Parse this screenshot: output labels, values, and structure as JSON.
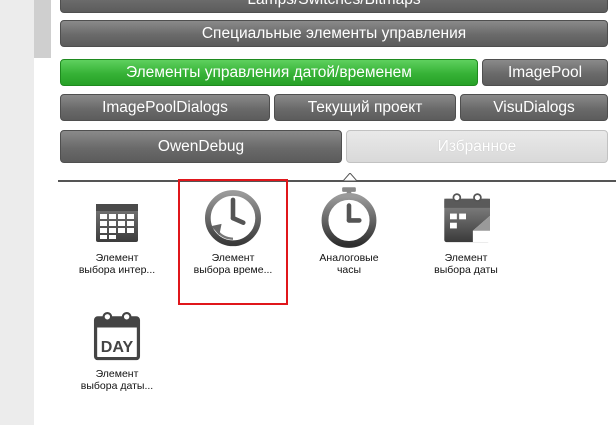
{
  "tabs": {
    "row0": "Lamps/Switches/Bitmaps",
    "row1": "Специальные элементы управления",
    "row2_active": "Элементы управления датой/временем",
    "row2_imagepool": "ImagePool",
    "row3_dialogs": "ImagePoolDialogs",
    "row3_project": "Текущий проект",
    "row3_visu": "VisuDialogs",
    "row4_owen": "OwenDebug",
    "row4_fav": "Избранное"
  },
  "colors": {
    "tab_dark": "#6a6a6a",
    "tab_active": "#36b236",
    "selection": "#e0161b"
  },
  "tools": [
    {
      "line1": "Элемент",
      "line2": "выбора интер...",
      "icon": "calendar-grid-icon"
    },
    {
      "line1": "Элемент",
      "line2": "выбора време...",
      "icon": "clock-pick-icon"
    },
    {
      "line1": "Аналоговые",
      "line2": "часы",
      "icon": "analog-clock-icon"
    },
    {
      "line1": "Элемент",
      "line2": "выбора даты",
      "icon": "calendar-date-icon"
    },
    {
      "line1": "Элемент",
      "line2": "выбора даты...",
      "icon": "day-calendar-icon"
    }
  ],
  "day_text": "DAY"
}
